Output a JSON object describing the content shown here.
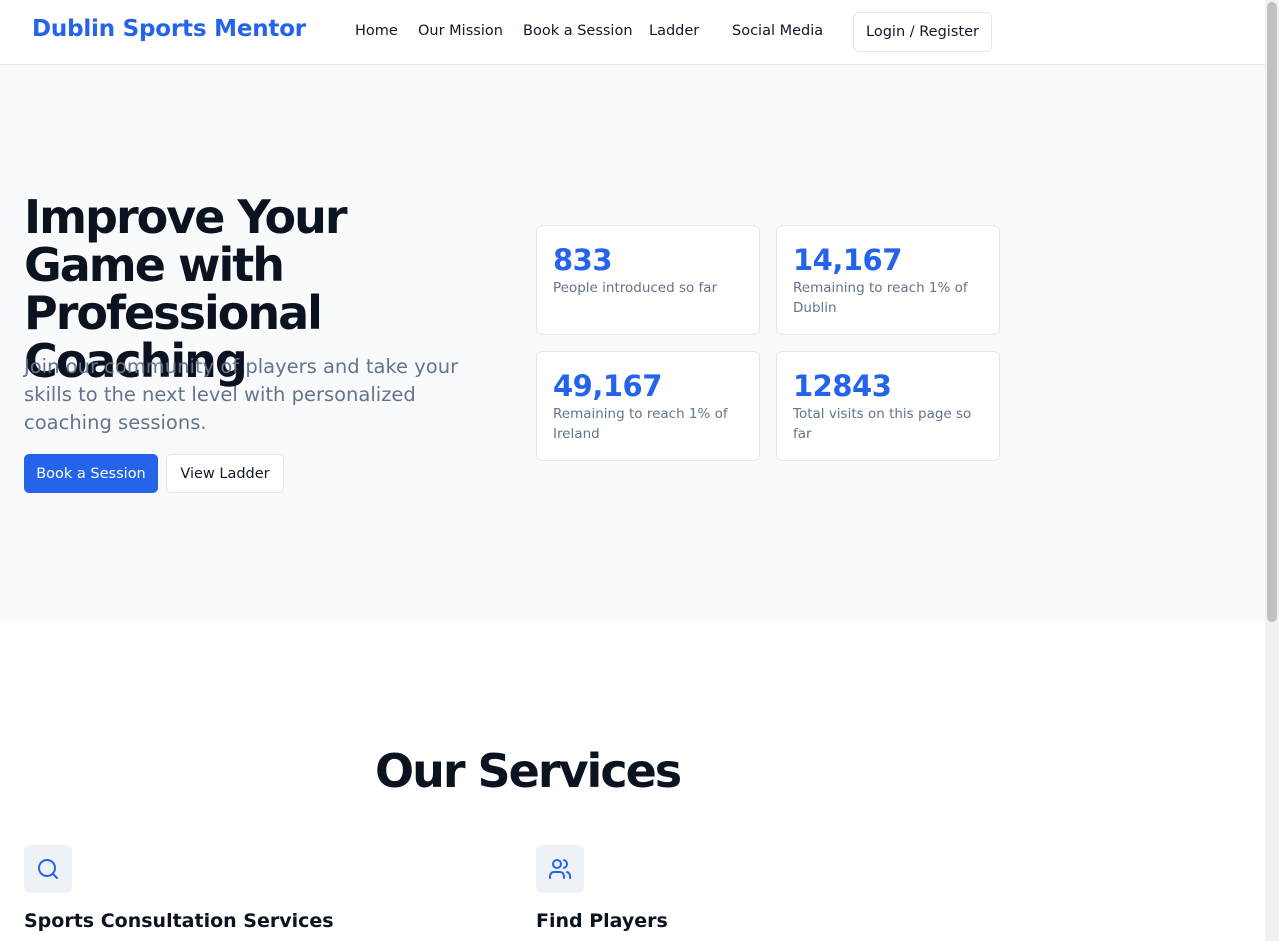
{
  "header": {
    "brand": "Dublin Sports Mentor",
    "nav": [
      {
        "label": "Home"
      },
      {
        "label": "Our Mission"
      },
      {
        "label": "Book a Session"
      },
      {
        "label": "Ladder"
      },
      {
        "label": "Social Media"
      }
    ],
    "login_label": "Login / Register"
  },
  "hero": {
    "title": "Improve Your Game with Professional Coaching",
    "subtitle": "Join our community of players and take your skills to the next level with personalized coaching sessions.",
    "primary_button": "Book a Session",
    "secondary_button": "View Ladder",
    "stats": [
      {
        "value": "833",
        "label": "People introduced so far"
      },
      {
        "value": "14,167",
        "label": "Remaining to reach 1% of Dublin"
      },
      {
        "value": "49,167",
        "label": "Remaining to reach 1% of Ireland"
      },
      {
        "value": "12843",
        "label": "Total visits on this page so far"
      }
    ]
  },
  "services": {
    "title": "Our Services",
    "items": [
      {
        "title": "Sports Consultation Services",
        "icon": "search-icon"
      },
      {
        "title": "Find Players",
        "icon": "users-icon"
      }
    ]
  },
  "colors": {
    "accent": "#2563eb",
    "hero_bg": "#f8fafc",
    "muted_text": "#64748b"
  }
}
